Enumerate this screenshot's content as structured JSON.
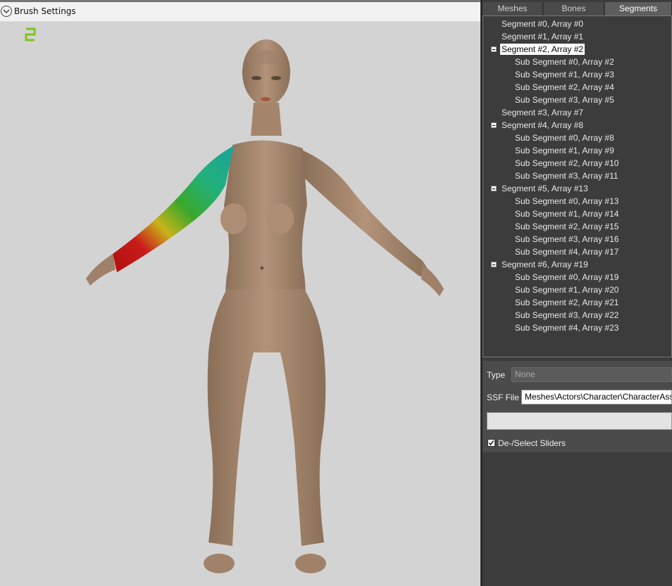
{
  "brush_settings": {
    "label": "Brush Settings",
    "icon": "chevron-down-icon"
  },
  "viewport": {
    "counter_text": "2",
    "counter_color": "#7fc31c",
    "background": "#d3d3d3"
  },
  "tabs": [
    {
      "label": "Meshes",
      "active": false
    },
    {
      "label": "Bones",
      "active": false
    },
    {
      "label": "Segments",
      "active": true
    }
  ],
  "tree": [
    {
      "label": "Segment #0, Array #0",
      "level": 0
    },
    {
      "label": "Segment #1, Array #1",
      "level": 0
    },
    {
      "label": "Segment #2, Array #2",
      "level": 0,
      "expanded": true,
      "selected": true
    },
    {
      "label": "Sub Segment #0, Array #2",
      "level": 1
    },
    {
      "label": "Sub Segment #1, Array #3",
      "level": 1
    },
    {
      "label": "Sub Segment #2, Array #4",
      "level": 1
    },
    {
      "label": "Sub Segment #3, Array #5",
      "level": 1
    },
    {
      "label": "Segment #3, Array #7",
      "level": 0
    },
    {
      "label": "Segment #4, Array #8",
      "level": 0,
      "expanded": true
    },
    {
      "label": "Sub Segment #0, Array #8",
      "level": 1
    },
    {
      "label": "Sub Segment #1, Array #9",
      "level": 1
    },
    {
      "label": "Sub Segment #2, Array #10",
      "level": 1
    },
    {
      "label": "Sub Segment #3, Array #11",
      "level": 1
    },
    {
      "label": "Segment #5, Array #13",
      "level": 0,
      "expanded": true
    },
    {
      "label": "Sub Segment #0, Array #13",
      "level": 1
    },
    {
      "label": "Sub Segment #1, Array #14",
      "level": 1
    },
    {
      "label": "Sub Segment #2, Array #15",
      "level": 1
    },
    {
      "label": "Sub Segment #3, Array #16",
      "level": 1
    },
    {
      "label": "Sub Segment #4, Array #17",
      "level": 1
    },
    {
      "label": "Segment #6, Array #19",
      "level": 0,
      "expanded": true
    },
    {
      "label": "Sub Segment #0, Array #19",
      "level": 1
    },
    {
      "label": "Sub Segment #1, Array #20",
      "level": 1
    },
    {
      "label": "Sub Segment #2, Array #21",
      "level": 1
    },
    {
      "label": "Sub Segment #3, Array #22",
      "level": 1
    },
    {
      "label": "Sub Segment #4, Array #23",
      "level": 1
    }
  ],
  "properties": {
    "type_label": "Type",
    "type_value": "None",
    "ssf_label": "SSF File",
    "ssf_value": "Meshes\\Actors\\Character\\CharacterAssets",
    "deselect_sliders_label": "De-/Select Sliders",
    "deselect_sliders_checked": true
  }
}
